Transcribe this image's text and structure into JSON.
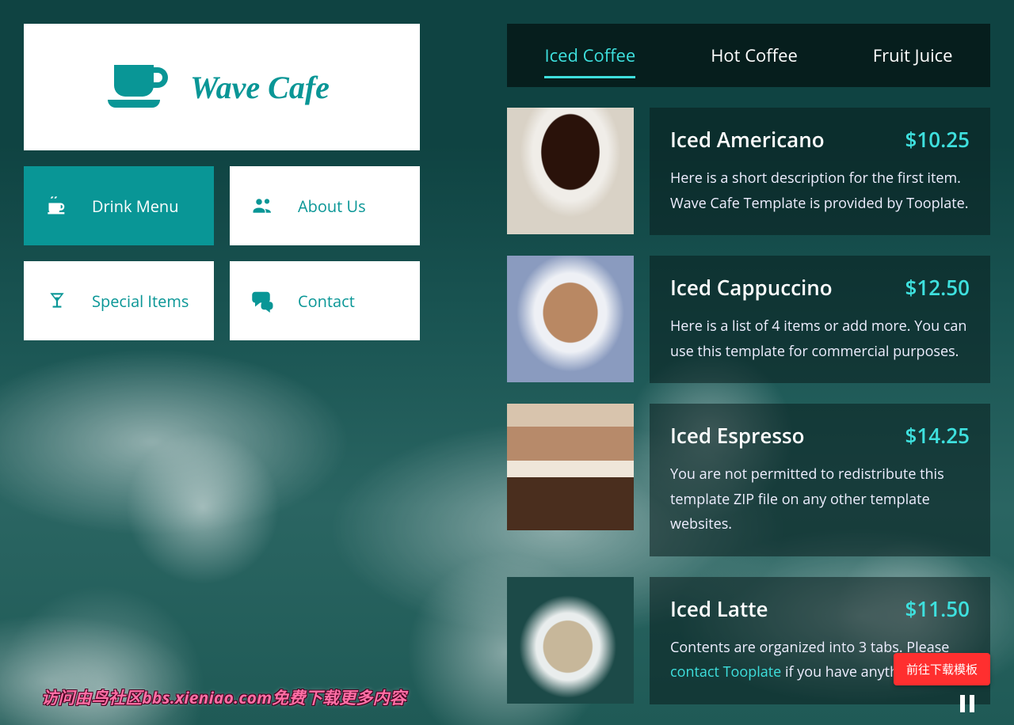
{
  "logo": {
    "text": "Wave Cafe"
  },
  "nav": [
    {
      "label": "Drink Menu",
      "icon": "cup-icon",
      "active": true
    },
    {
      "label": "About Us",
      "icon": "users-icon",
      "active": false
    },
    {
      "label": "Special Items",
      "icon": "glass-icon",
      "active": false
    },
    {
      "label": "Contact",
      "icon": "chat-icon",
      "active": false
    }
  ],
  "tabs": [
    {
      "label": "Iced Coffee",
      "active": true
    },
    {
      "label": "Hot Coffee",
      "active": false
    },
    {
      "label": "Fruit Juice",
      "active": false
    }
  ],
  "menu_items": [
    {
      "title": "Iced Americano",
      "price": "$10.25",
      "desc": "Here is a short description for the first item. Wave Cafe Template is provided by Tooplate."
    },
    {
      "title": "Iced Cappuccino",
      "price": "$12.50",
      "desc": "Here is a list of 4 items or add more. You can use this template for commercial purposes."
    },
    {
      "title": "Iced Espresso",
      "price": "$14.25",
      "desc": "You are not permitted to redistribute this template ZIP file on any other template websites."
    },
    {
      "title": "Iced Latte",
      "price": "$11.50",
      "desc_prefix": "Contents are organized into 3 tabs. Please ",
      "link_text": "contact Tooplate",
      "desc_suffix": " if you have anything to ask."
    }
  ],
  "download_label": "前往下载模板",
  "footer_text": "访问由鸟社区bbs.xieniao.com免费下载更多内容"
}
